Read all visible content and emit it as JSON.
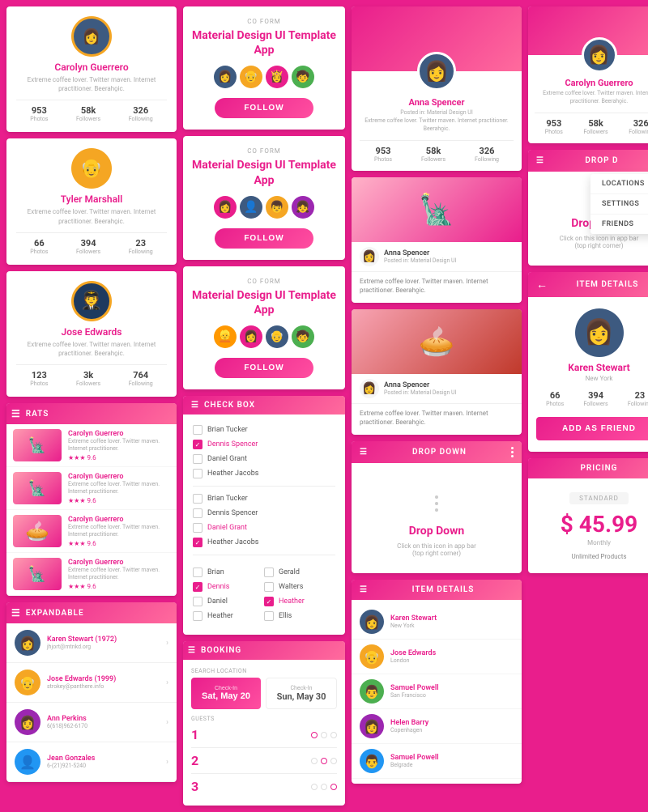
{
  "col1": {
    "profile1": {
      "name": "Carolyn Guerrero",
      "bio": "Extreme coffee lover. Twitter maven. Internet practitioner. Beeraho̠ic.",
      "stats": {
        "photos": "953",
        "followers": "58k",
        "following": "326"
      },
      "photos_label": "Photos",
      "followers_label": "Followers",
      "following_label": "Following"
    },
    "profile2": {
      "name": "Tyler Marshall",
      "bio": "Extreme coffee lover. Twitter maven. Internet practitioner. Beeraho̠ic.",
      "stats": {
        "photos": "66",
        "followers": "394",
        "following": "23"
      }
    },
    "profile3": {
      "name": "Jose Edwards",
      "bio": "Extreme coffee lover. Twitter maven. Internet practitioner. Beeraho̠ic.",
      "stats": {
        "photos": "123",
        "followers": "3k",
        "following": "764"
      }
    },
    "rate_header": "RATS",
    "rate_items": [
      {
        "name": "Carolyn Guerrero",
        "desc": "Extreme coffee lover. Twitter maven. Internet practitioner.",
        "stars": "★★★ 9.6"
      },
      {
        "name": "Carolyn Guerrero",
        "desc": "Extreme coffee lover. Twitter maven. Internet practitioner.",
        "stars": "★★★ 9.6"
      },
      {
        "name": "Carolyn Guerrero",
        "desc": "Extreme coffee lover. Twitter maven. Internet practitioner.",
        "stars": "★★★ 9.6"
      },
      {
        "name": "Carolyn Guerrero",
        "desc": "Extreme coffee lover. Twitter maven. Internet practitioner.",
        "stars": "★★★ 9.6"
      }
    ],
    "expandable_header": "EXPANDABLE",
    "expand_items": [
      {
        "name": "Karen Stewart (1972)",
        "sub": "jhjort@mtnkd.org"
      },
      {
        "name": "Jose Edwards (1999)",
        "sub": "strokey@panthere.info"
      },
      {
        "name": "Ann Perkins",
        "sub": "6(618)962-6170"
      },
      {
        "name": "Jean Gonzales",
        "sub": "6-(21)921-5240"
      }
    ]
  },
  "col2": {
    "coform_label": "CO FORM",
    "coform_title": "Material Design UI Template App",
    "follow_label": "FOLLOW",
    "avatars": [
      "🧑",
      "👩",
      "👦",
      "👧"
    ],
    "checkbox_header": "CHECK BOX",
    "checkboxes_top": [
      {
        "label": "Brian Tucker",
        "checked": false
      },
      {
        "label": "Dennis Spencer",
        "checked": true
      },
      {
        "label": "Daniel Grant",
        "checked": false
      },
      {
        "label": "Heather Jacobs",
        "checked": false
      }
    ],
    "checkboxes_mid": [
      {
        "label": "Brian Tucker",
        "checked": false
      },
      {
        "label": "Dennis Spencer",
        "checked": false
      },
      {
        "label": "Daniel Grant",
        "checked": false
      },
      {
        "label": "Heather Jacobs",
        "checked": true
      }
    ],
    "checkboxes_grid": [
      {
        "label": "Brian",
        "checked": false
      },
      {
        "label": "Gerald",
        "checked": false
      },
      {
        "label": "Dennis",
        "checked": true
      },
      {
        "label": "Walters",
        "checked": false
      },
      {
        "label": "Daniel",
        "checked": false
      },
      {
        "label": "Heather",
        "checked": true
      },
      {
        "label": "Heather",
        "checked": false
      },
      {
        "label": "Ellis",
        "checked": false
      }
    ],
    "booking_header": "BOOKING",
    "search_loc_label": "SEARCH LOCATION",
    "date1": {
      "label": "Check-In",
      "value": "Sat, May 20"
    },
    "date2": {
      "label": "Check-In",
      "value": "Sun, May 30"
    },
    "guests_label": "GUESTS",
    "stepper_rows": [
      1,
      2,
      3
    ]
  },
  "col3": {
    "profile": {
      "name": "Anna Spencer",
      "bio": "Posted in: Material Design UI",
      "full_bio": "Extreme coffee lover. Twitter maven. Internet practitioner. Beeraho̠ic.",
      "stats": {
        "photos": "953",
        "followers": "58k",
        "following": "326"
      }
    },
    "blog_author1": {
      "name": "Anna Spencer",
      "sub": "Posted in: Material Design UI"
    },
    "blog_author2": {
      "name": "Anna Spencer",
      "sub": "Posted in: Material Design UI"
    },
    "blog_desc": "Extreme coffee lover. Twitter maven. Internet practitioner. Beeraho̠ic.",
    "dropdown_header": "DROP DOWN",
    "dropdown_title": "Drop Down",
    "dropdown_hint": "Click on this icon in app bar\n(top right corner)",
    "item_details_header": "ITEM DETAILS",
    "item_list": [
      {
        "name": "Karen Stewart",
        "loc": "New York"
      },
      {
        "name": "Jose Edwards",
        "loc": "London"
      },
      {
        "name": "Samuel Powell",
        "loc": "San Francisco"
      },
      {
        "name": "Helen Barry",
        "loc": "Copenhagen"
      },
      {
        "name": "Samuel Powell",
        "loc": "Belgrade"
      }
    ]
  },
  "col4": {
    "profile": {
      "name": "Carolyn Guerrero",
      "bio": "Extreme coffee lover. Twitter maven. Internet practitioner. Beeraho̠ic.",
      "stats": {
        "photos": "953",
        "followers": "58k",
        "following": "326"
      }
    },
    "dropdown_header": "DROP D",
    "dropdown_menu": [
      {
        "label": "LOCATIONS"
      },
      {
        "label": "SETTINGS"
      },
      {
        "label": "FRIENDS"
      }
    ],
    "dropdown_title": "Drop Down",
    "dropdown_hint": "Click on this icon in app bar\n(top right corner)",
    "item_details_header": "ITEM DETAILS",
    "detail_person": {
      "name": "Karen Stewart",
      "loc": "New York",
      "stats": {
        "photos": "66",
        "followers": "394",
        "following": "23"
      },
      "photos_label": "Photos",
      "followers_label": "Followers",
      "following_label": "Following"
    },
    "add_friend_label": "ADD AS FRIEND",
    "pricing_header": "PRICING",
    "pricing_badge": "STANDARD",
    "pricing_price": "$ 45.99",
    "pricing_period": "Monthly",
    "pricing_feature": "Unlimited Products"
  }
}
